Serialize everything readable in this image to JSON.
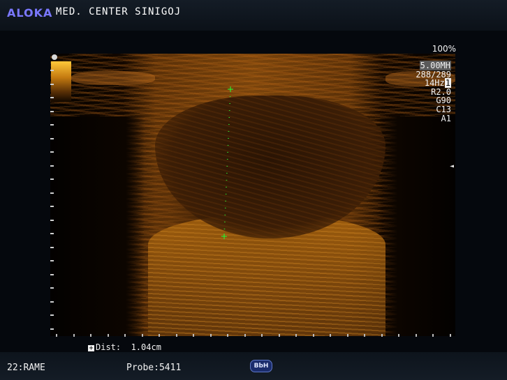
{
  "header": {
    "brand": "ALOKA",
    "brand_color": "#7a78ff",
    "center_name": "MED. CENTER SINIGOJ"
  },
  "display": {
    "zoom": "100%",
    "frequency": "5.00MH",
    "frames": "288/289",
    "frame_rate": "14Hz",
    "frame_rate_index": "1",
    "r": "R2.0",
    "gain": "G90",
    "contrast": "C13",
    "a": "A1",
    "focus_marker": "◄"
  },
  "measurement": {
    "label": "Dist:",
    "value": "1.04cm",
    "marker_symbol": "+",
    "caliper_color": "#2ee82e"
  },
  "footer": {
    "preset": "22:RAME",
    "probe": "Probe:5411",
    "badge": "BbH"
  }
}
